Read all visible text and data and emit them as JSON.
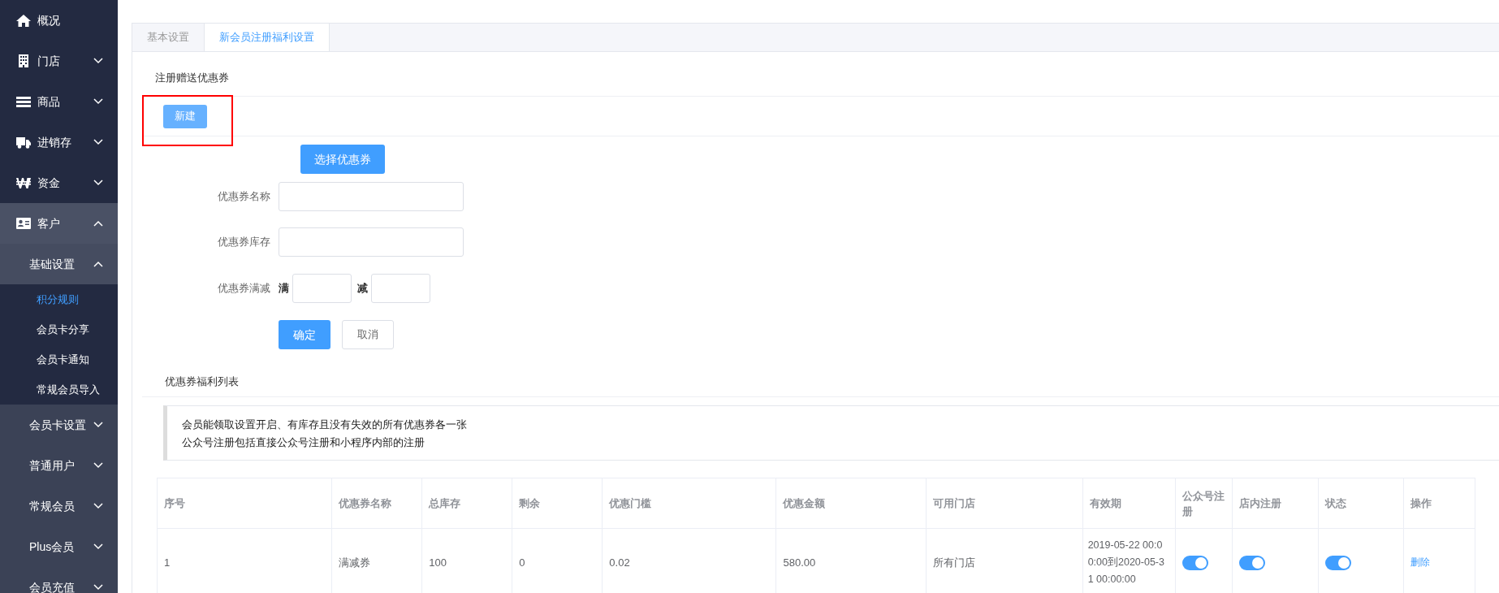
{
  "sidebar": {
    "items": [
      {
        "label": "概况",
        "kind": "home"
      },
      {
        "label": "门店",
        "kind": "building",
        "expanded": false
      },
      {
        "label": "商品",
        "kind": "bars",
        "expanded": false
      },
      {
        "label": "进销存",
        "kind": "truck",
        "expanded": false
      },
      {
        "label": "资金",
        "kind": "won",
        "expanded": false
      },
      {
        "label": "客户",
        "kind": "idcard",
        "expanded": true,
        "children": [
          {
            "label": "基础设置",
            "expanded": true,
            "children": [
              {
                "label": "积分规则",
                "selected": true
              },
              {
                "label": "会员卡分享",
                "selected": false
              },
              {
                "label": "会员卡通知",
                "selected": false
              },
              {
                "label": "常规会员导入",
                "selected": false
              }
            ]
          },
          {
            "label": "会员卡设置",
            "expanded": false
          },
          {
            "label": "普通用户",
            "expanded": false
          },
          {
            "label": "常规会员",
            "expanded": false
          },
          {
            "label": "Plus会员",
            "expanded": false
          },
          {
            "label": "会员充值",
            "expanded": false
          }
        ]
      }
    ]
  },
  "tabs": [
    {
      "label": "基本设置",
      "selected": false
    },
    {
      "label": "新会员注册福利设置",
      "selected": true
    }
  ],
  "coupon_section": {
    "title": "注册赠送优惠券",
    "new_button": {
      "label": "新建",
      "highlighted": true
    },
    "select_button": "选择优惠券",
    "fields": [
      {
        "kind": "text",
        "label": "优惠券名称"
      },
      {
        "kind": "text",
        "label": "优惠券库存"
      },
      {
        "kind": "range",
        "label": "优惠券满减",
        "prefix_min": "满",
        "prefix_cut": "减"
      }
    ],
    "confirm_button": "确定",
    "cancel_button": "取消"
  },
  "list_section": {
    "title": "优惠券福利列表",
    "notes": [
      "会员能领取设置开启、有库存且没有失效的所有优惠券各一张",
      "公众号注册包括直接公众号注册和小程序内部的注册"
    ],
    "table": {
      "columns": [
        "序号",
        "优惠券名称",
        "总库存",
        "剩余",
        "优惠门槛",
        "优惠金额",
        "可用门店",
        "有效期",
        "公众号注册",
        "店内注册",
        "状态",
        "操作"
      ],
      "rows": [
        {
          "index": "1",
          "name": "满减券",
          "total": "100",
          "remaining": "0",
          "threshold": "0.02",
          "amount": "580.00",
          "stores": "所有门店",
          "validity": "2019-05-22 00:00:00到2020-05-31 00:00:00",
          "wechat_register": true,
          "store_register": true,
          "status": true,
          "action": "删除"
        }
      ]
    }
  }
}
